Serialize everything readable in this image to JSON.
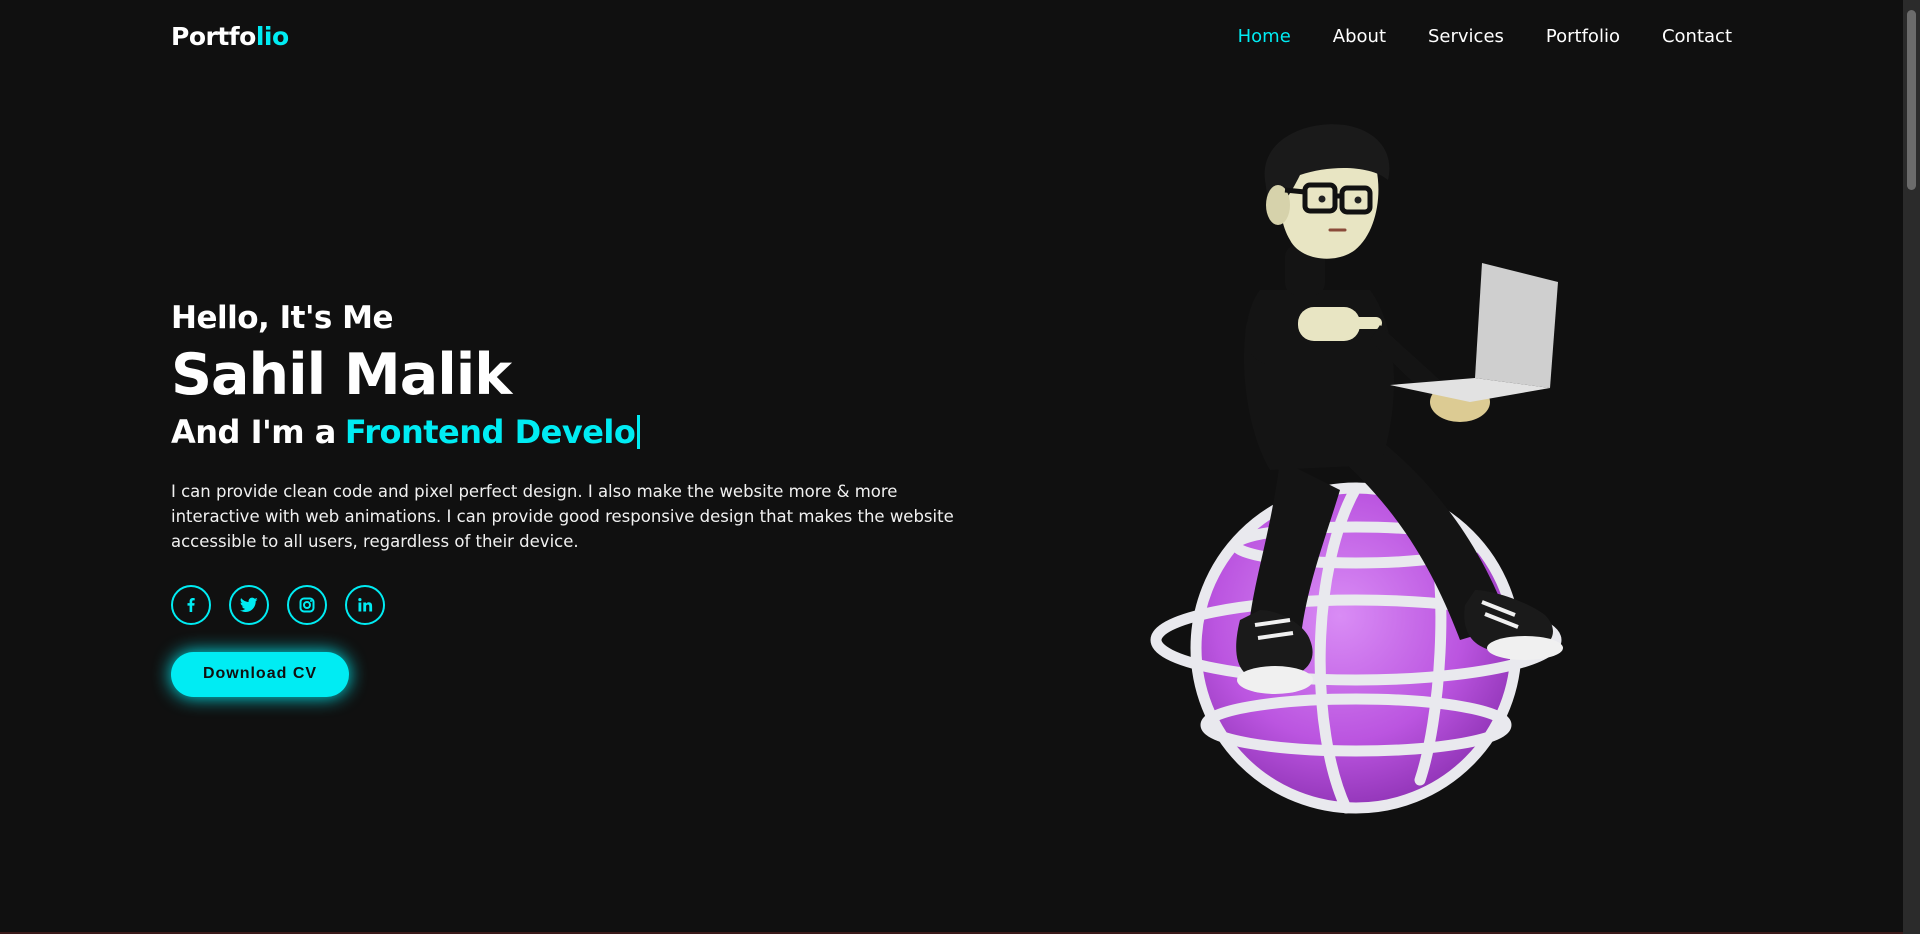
{
  "header": {
    "logo_main": "Portfo",
    "logo_accent": "lio",
    "nav": [
      {
        "label": "Home",
        "active": true
      },
      {
        "label": "About",
        "active": false
      },
      {
        "label": "Services",
        "active": false
      },
      {
        "label": "Portfolio",
        "active": false
      },
      {
        "label": "Contact",
        "active": false
      }
    ]
  },
  "hero": {
    "greeting": "Hello, It's Me",
    "name": "Sahil Malik",
    "role_prefix": "And I'm a",
    "role_typed": "Frontend Develo",
    "description": "I can provide clean code and pixel perfect design. I also make the website more & more interactive with web animations. I can provide good responsive design that makes the website accessible to all users, regardless of their device.",
    "socials": [
      {
        "icon": "facebook-icon"
      },
      {
        "icon": "twitter-icon"
      },
      {
        "icon": "instagram-icon"
      },
      {
        "icon": "linkedin-icon"
      }
    ],
    "cv_button": "Download CV"
  },
  "colors": {
    "background": "#101010",
    "accent": "#00ecf3",
    "globe": "#c25ee6"
  }
}
